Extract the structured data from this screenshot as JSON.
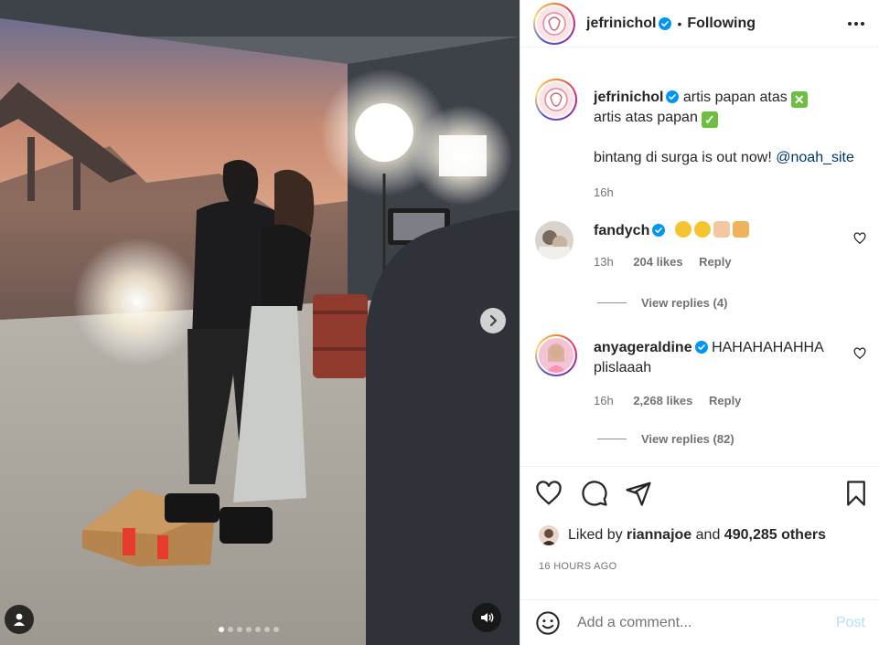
{
  "header": {
    "username": "jefrinichol",
    "separator": "•",
    "follow_status": "Following"
  },
  "caption": {
    "username": "jefrinichol",
    "line1": "artis papan atas",
    "line2": "artis atas papan",
    "line3_prefix": "bintang di surga is out now!",
    "mention": "@noah_site",
    "time": "16h"
  },
  "comments": [
    {
      "username": "fandych",
      "text": "",
      "time": "13h",
      "likes": "204 likes",
      "reply": "Reply",
      "view_replies": "View replies (4)"
    },
    {
      "username": "anyageraldine",
      "text": "HAHAHAHAHHA",
      "text2": "plislaaah",
      "time": "16h",
      "likes": "2,268 likes",
      "reply": "Reply",
      "view_replies": "View replies (82)"
    }
  ],
  "likes_line": {
    "prefix": "Liked by",
    "user": "riannajoe",
    "middle": "and",
    "count": "490,285 others"
  },
  "post_time": "16 HOURS AGO",
  "comment_box": {
    "placeholder": "Add a comment...",
    "post_label": "Post"
  },
  "carousel": {
    "total": 7,
    "current": 1
  },
  "colors": {
    "link": "#00376b",
    "post_disabled": "#b2dffc",
    "verified": "#0095f6"
  },
  "icons": [
    "more-icon",
    "verified-icon",
    "heart-icon",
    "comment-icon",
    "share-icon",
    "save-icon",
    "emoji-icon",
    "chevron-right-icon",
    "user-tag-icon",
    "audio-icon"
  ]
}
